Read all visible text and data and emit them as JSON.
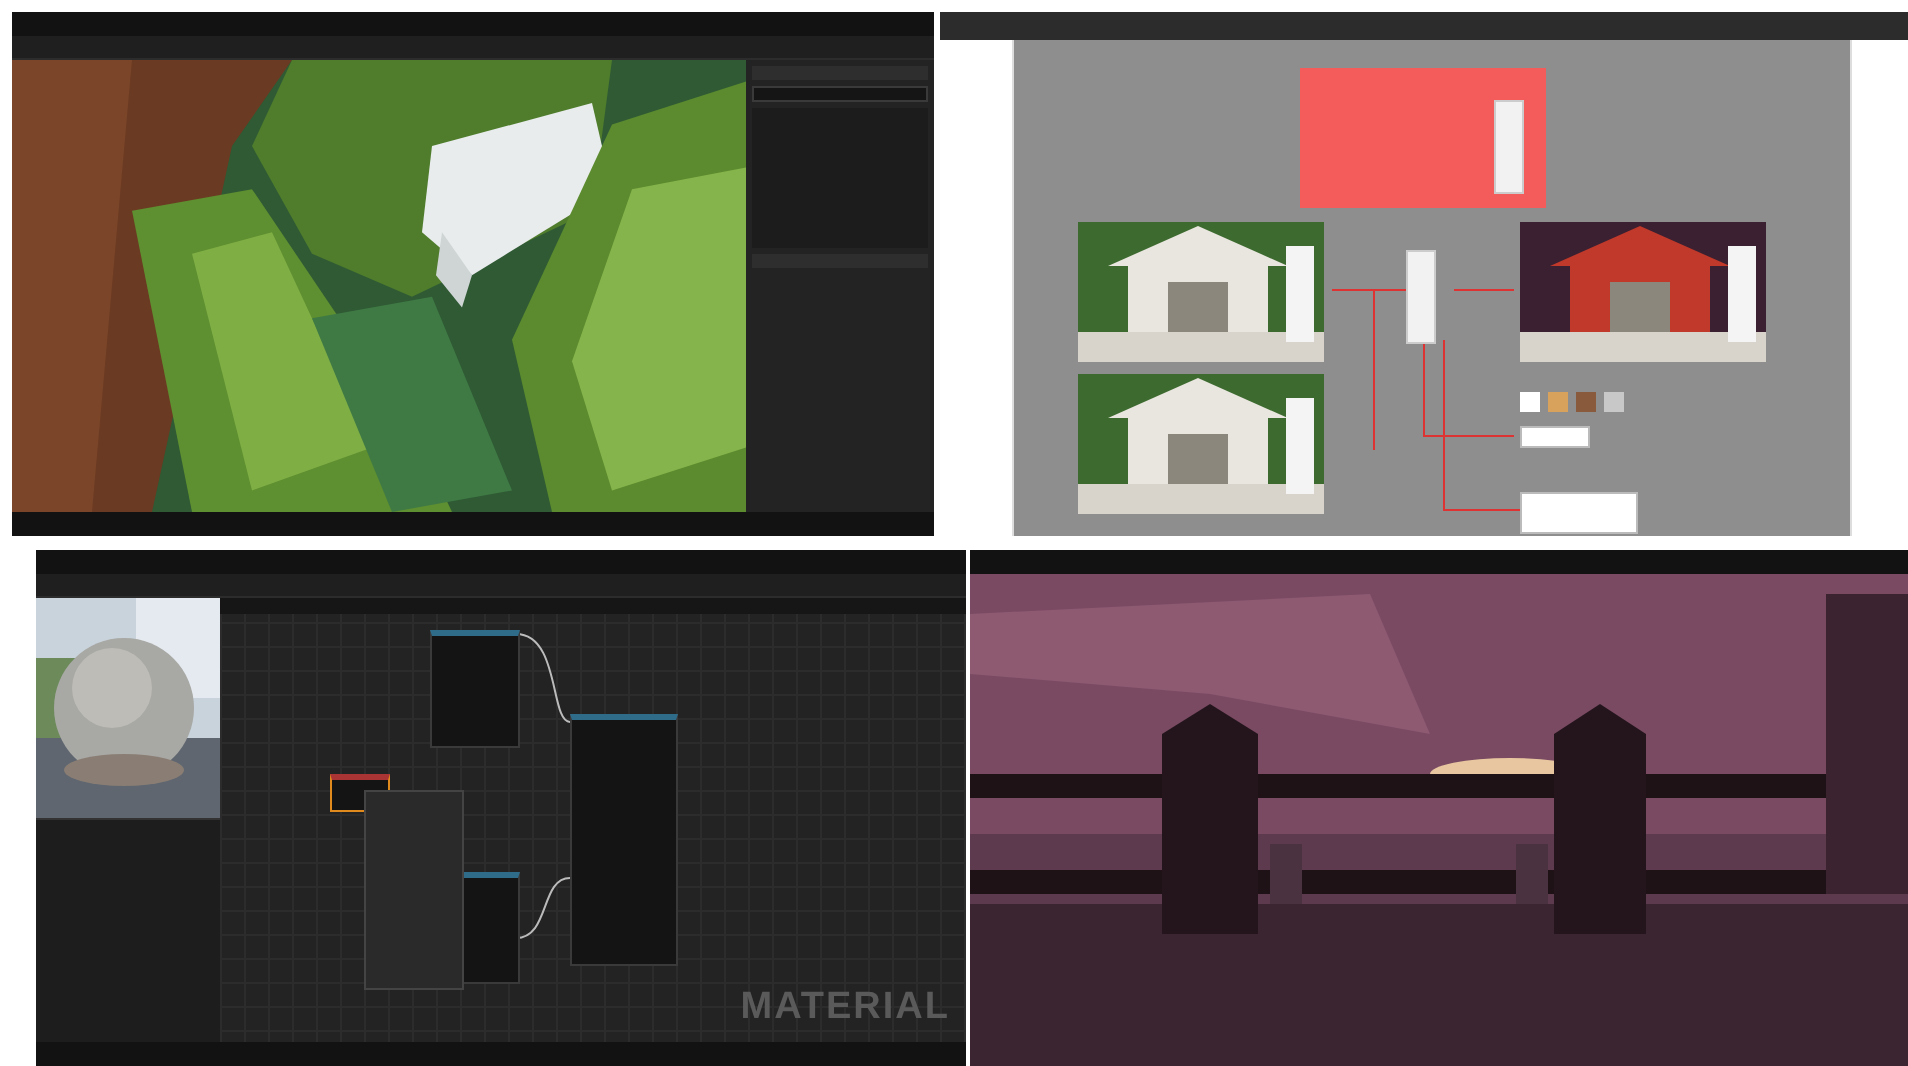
{
  "panels": [
    {
      "kind": "level_editor"
    },
    {
      "kind": "design_board",
      "swatches": [
        {
          "color": "#ffffff"
        },
        {
          "color": "#d9a25c"
        },
        {
          "color": "#8a5a3c"
        },
        {
          "color": "#c8c8c8"
        }
      ]
    },
    {
      "kind": "material_editor",
      "graph_label": "MATERIAL"
    },
    {
      "kind": "game_view"
    }
  ]
}
